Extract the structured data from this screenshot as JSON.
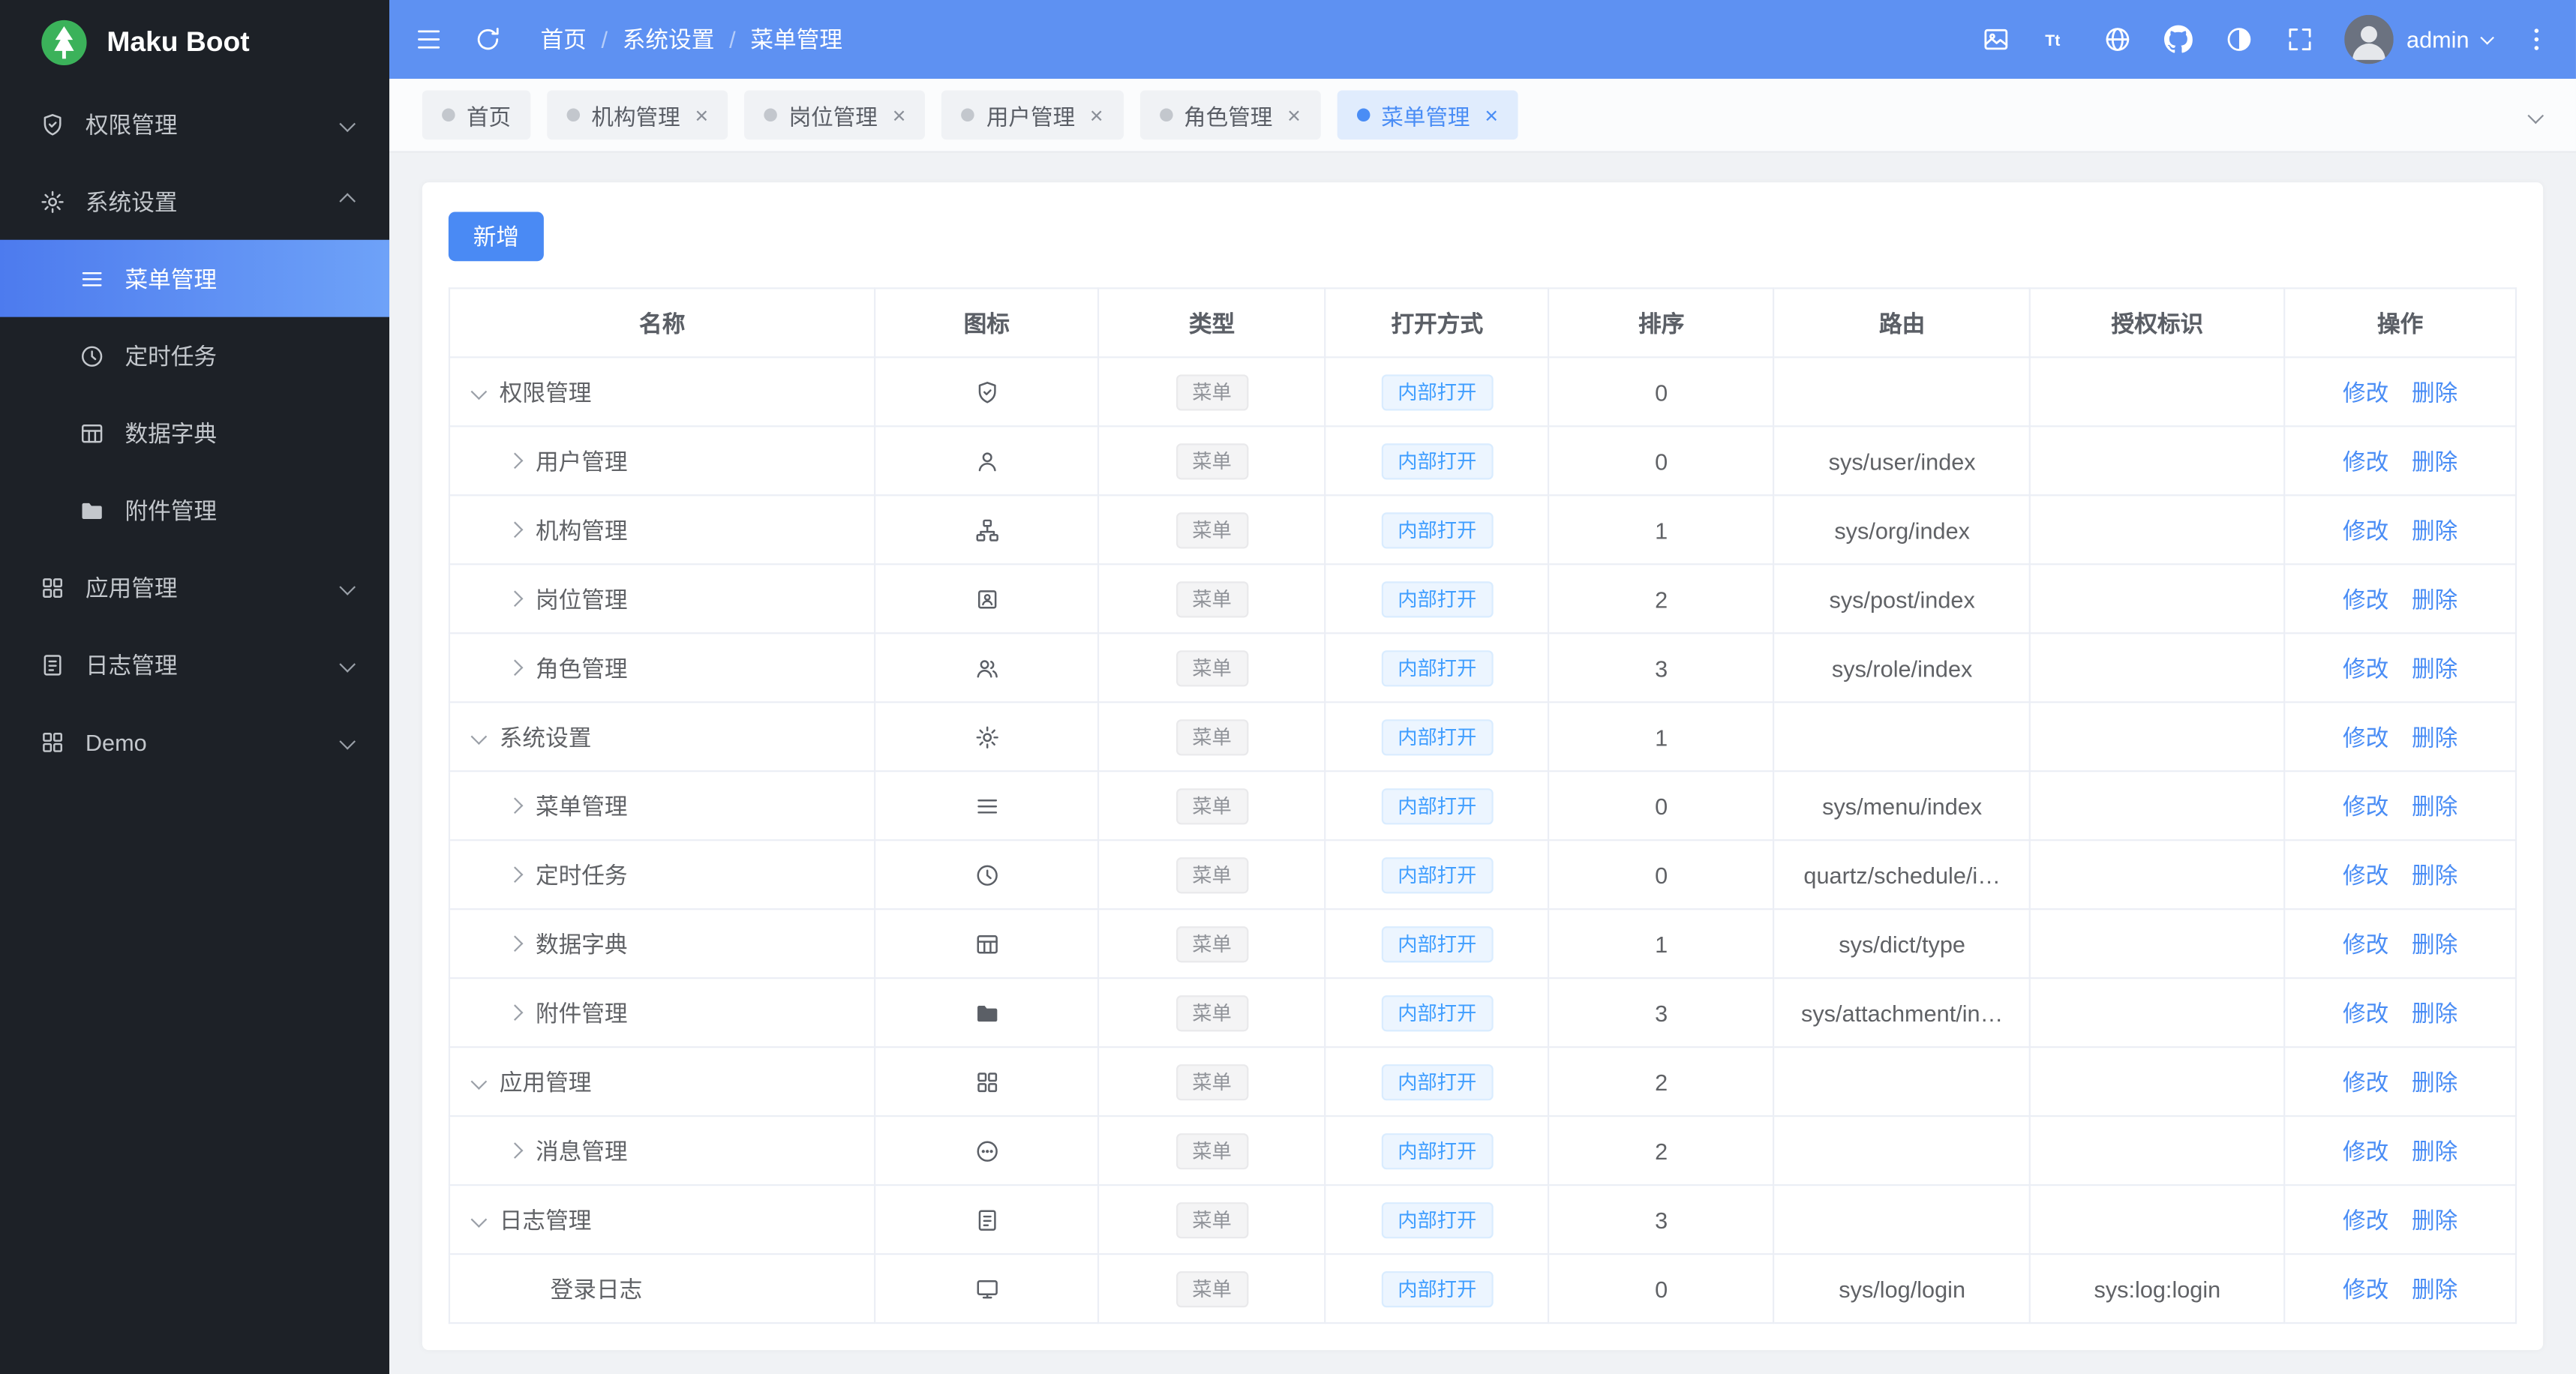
{
  "app": {
    "title": "Maku Boot"
  },
  "colors": {
    "header_blue": "#5e91f2",
    "sidebar_bg": "#1d2127",
    "active_blue": "#4a8df5",
    "link_blue": "#4a8df5",
    "logo_green": "#3bb25a",
    "tag_info_text": "#909399",
    "tag_open_text": "#409eff"
  },
  "sidebar": {
    "logo_text": "Maku Boot",
    "items": [
      {
        "id": "permissions",
        "label": "权限管理",
        "icon": "shield-icon",
        "chevron": "down"
      },
      {
        "id": "system-settings",
        "label": "系统设置",
        "icon": "gear-icon",
        "chevron": "up",
        "expanded": true,
        "children": [
          {
            "id": "menu-management",
            "label": "菜单管理",
            "icon": "menu-icon",
            "active": true
          },
          {
            "id": "scheduled-tasks",
            "label": "定时任务",
            "icon": "clock-icon"
          },
          {
            "id": "data-dictionary",
            "label": "数据字典",
            "icon": "dict-icon"
          },
          {
            "id": "attachment-management",
            "label": "附件管理",
            "icon": "folder-icon"
          }
        ]
      },
      {
        "id": "app-management",
        "label": "应用管理",
        "icon": "app-grid-icon",
        "chevron": "down"
      },
      {
        "id": "log-management",
        "label": "日志管理",
        "icon": "log-icon",
        "chevron": "down"
      },
      {
        "id": "demo",
        "label": "Demo",
        "icon": "demo-icon",
        "chevron": "down"
      }
    ]
  },
  "header": {
    "left_icons": [
      "collapse-icon",
      "refresh-icon"
    ],
    "breadcrumb": [
      "首页",
      "系统设置",
      "菜单管理"
    ],
    "breadcrumb_separator": "/",
    "right_icons": [
      "image-icon",
      "font-size-icon",
      "language-icon",
      "github-icon",
      "theme-icon",
      "fullscreen-icon"
    ],
    "user": {
      "name": "admin"
    },
    "more_icon": "more-vertical-icon"
  },
  "tabs": [
    {
      "label": "首页",
      "closable": false,
      "active": false
    },
    {
      "label": "机构管理",
      "closable": true,
      "active": false
    },
    {
      "label": "岗位管理",
      "closable": true,
      "active": false
    },
    {
      "label": "用户管理",
      "closable": true,
      "active": false
    },
    {
      "label": "角色管理",
      "closable": true,
      "active": false
    },
    {
      "label": "菜单管理",
      "closable": true,
      "active": true
    }
  ],
  "toolbar": {
    "add_label": "新增"
  },
  "table": {
    "columns": [
      "名称",
      "图标",
      "类型",
      "打开方式",
      "排序",
      "路由",
      "授权标识",
      "操作"
    ],
    "type_tag": "菜单",
    "open_tag": "内部打开",
    "action_edit": "修改",
    "action_delete": "删除",
    "rows": [
      {
        "name": "权限管理",
        "indent": 0,
        "expander": "down",
        "icon": "shield-icon",
        "sort": "0",
        "route": "",
        "auth": ""
      },
      {
        "name": "用户管理",
        "indent": 1,
        "expander": "right",
        "icon": "user-icon",
        "sort": "0",
        "route": "sys/user/index",
        "auth": ""
      },
      {
        "name": "机构管理",
        "indent": 1,
        "expander": "right",
        "icon": "org-icon",
        "sort": "1",
        "route": "sys/org/index",
        "auth": ""
      },
      {
        "name": "岗位管理",
        "indent": 1,
        "expander": "right",
        "icon": "post-icon",
        "sort": "2",
        "route": "sys/post/index",
        "auth": ""
      },
      {
        "name": "角色管理",
        "indent": 1,
        "expander": "right",
        "icon": "role-icon",
        "sort": "3",
        "route": "sys/role/index",
        "auth": ""
      },
      {
        "name": "系统设置",
        "indent": 0,
        "expander": "down",
        "icon": "gear-icon",
        "sort": "1",
        "route": "",
        "auth": ""
      },
      {
        "name": "菜单管理",
        "indent": 1,
        "expander": "right",
        "icon": "menu-icon",
        "sort": "0",
        "route": "sys/menu/index",
        "auth": ""
      },
      {
        "name": "定时任务",
        "indent": 1,
        "expander": "right",
        "icon": "clock-icon",
        "sort": "0",
        "route": "quartz/schedule/i…",
        "auth": ""
      },
      {
        "name": "数据字典",
        "indent": 1,
        "expander": "right",
        "icon": "dict-icon",
        "sort": "1",
        "route": "sys/dict/type",
        "auth": ""
      },
      {
        "name": "附件管理",
        "indent": 1,
        "expander": "right",
        "icon": "folder-icon",
        "sort": "3",
        "route": "sys/attachment/in…",
        "auth": ""
      },
      {
        "name": "应用管理",
        "indent": 0,
        "expander": "down",
        "icon": "app-grid-icon",
        "sort": "2",
        "route": "",
        "auth": ""
      },
      {
        "name": "消息管理",
        "indent": 1,
        "expander": "right",
        "icon": "message-icon",
        "sort": "2",
        "route": "",
        "auth": ""
      },
      {
        "name": "日志管理",
        "indent": 0,
        "expander": "down",
        "icon": "log-icon",
        "sort": "3",
        "route": "",
        "auth": ""
      },
      {
        "name": "登录日志",
        "indent": 1,
        "expander": "none",
        "icon": "login-log-icon",
        "sort": "0",
        "route": "sys/log/login",
        "auth": "sys:log:login"
      }
    ]
  }
}
